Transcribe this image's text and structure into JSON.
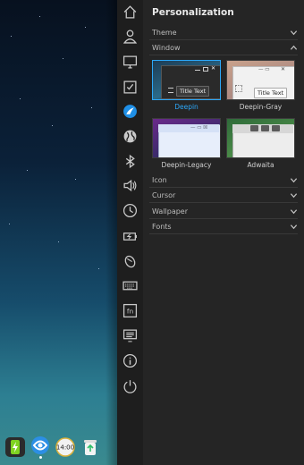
{
  "dock": {
    "items": [
      {
        "icon": "power-icon",
        "color": "#7fd321"
      },
      {
        "icon": "deepin-store-icon",
        "color": "#2c8fe5"
      },
      {
        "icon": "clock-icon",
        "text": "14:00"
      },
      {
        "icon": "trash-icon",
        "color": "#2fbf6a"
      }
    ]
  },
  "nav": {
    "items": [
      "home-icon",
      "account-icon",
      "display-icon",
      "default-apps-icon",
      "personalization-icon",
      "network-icon",
      "bluetooth-icon",
      "sound-icon",
      "datetime-icon",
      "power-icon",
      "mouse-icon",
      "keyboard-icon",
      "shortcuts-icon",
      "system-info-icon",
      "info-icon",
      "shutdown-icon"
    ]
  },
  "panel": {
    "title": "Personalization",
    "sections": {
      "theme": "Theme",
      "window": "Window",
      "icon": "Icon",
      "cursor": "Cursor",
      "wallpaper": "Wallpaper",
      "fonts": "Fonts"
    },
    "themes": [
      {
        "name": "Deepin",
        "tooltip": "Title Text",
        "selected": true
      },
      {
        "name": "Deepin-Gray",
        "tooltip": "Title Text",
        "selected": false
      },
      {
        "name": "Deepin-Legacy",
        "selected": false
      },
      {
        "name": "Adwaita",
        "selected": false
      }
    ],
    "accent_color": "#2ca7f8"
  }
}
